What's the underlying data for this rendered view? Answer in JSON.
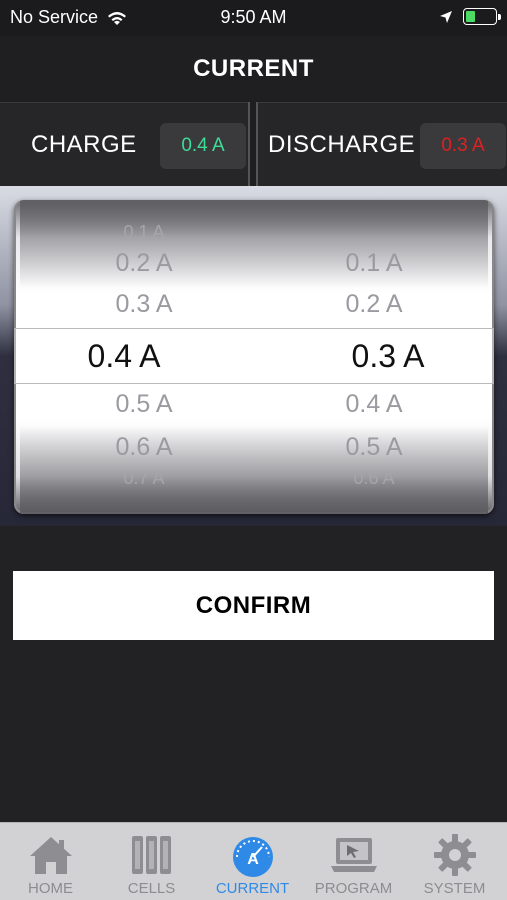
{
  "status_bar": {
    "carrier": "No Service",
    "time": "9:50 AM"
  },
  "header": {
    "title": "CURRENT"
  },
  "selection": {
    "charge_label": "CHARGE",
    "charge_value": "0.4 A",
    "charge_color": "#3ddc97",
    "discharge_label": "DISCHARGE",
    "discharge_value": "0.3 A",
    "discharge_color": "#e02020"
  },
  "picker": {
    "charge_items": [
      "0.1 A",
      "0.2 A",
      "0.3 A",
      "0.4 A",
      "0.5 A",
      "0.6 A",
      "0.7 A"
    ],
    "discharge_items": [
      "0.1 A",
      "0.2 A",
      "0.3 A",
      "0.4 A",
      "0.5 A",
      "0.6 A"
    ]
  },
  "confirm_label": "CONFIRM",
  "tabs": [
    {
      "label": "HOME",
      "icon": "home-icon"
    },
    {
      "label": "CELLS",
      "icon": "cells-icon"
    },
    {
      "label": "CURRENT",
      "icon": "gauge-icon",
      "active": true
    },
    {
      "label": "PROGRAM",
      "icon": "laptop-icon"
    },
    {
      "label": "SYSTEM",
      "icon": "gear-icon"
    }
  ],
  "colors": {
    "accent": "#2e8ae6"
  }
}
